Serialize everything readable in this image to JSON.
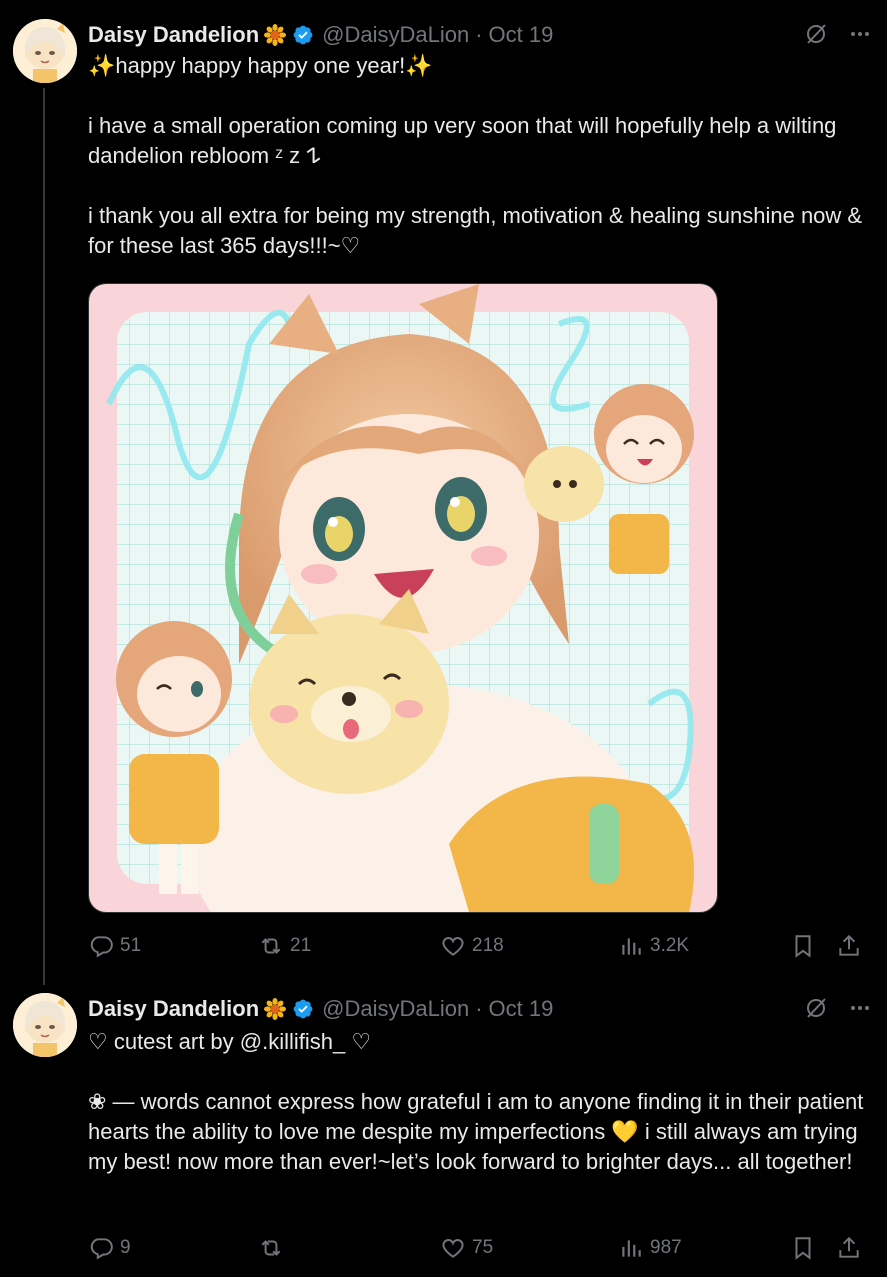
{
  "colors": {
    "background": "#000000",
    "text": "#e7e9ea",
    "muted": "#71767b",
    "verified": "#1d9bf0",
    "divider": "#2f3336"
  },
  "tweets": [
    {
      "author": {
        "name": "Daisy Dandelion",
        "handle": "@DaisyDaLion",
        "badge_icon": "sunflower-emoji",
        "verified_icon": "verified-badge-icon"
      },
      "date": "Oct 19",
      "text": "✨happy happy happy one year!✨\n\ni have a small operation coming up very soon that will hopefully help a wilting dandelion rebloom ᶻ z 𐰁\n\ni thank you all extra for being my strength, motivation & healing sunshine now & for these last 365 days!!!~♡",
      "media": {
        "type": "image",
        "description_icon": "anime-illustration"
      },
      "stats": {
        "replies": "51",
        "reposts": "21",
        "likes": "218",
        "views": "3.2K"
      }
    },
    {
      "author": {
        "name": "Daisy Dandelion",
        "handle": "@DaisyDaLion",
        "badge_icon": "sunflower-emoji",
        "verified_icon": "verified-badge-icon"
      },
      "date": "Oct 19",
      "text": "♡ cutest art by @.killifish_ ♡\n\n❀ — words cannot express how grateful i am to anyone finding it in their patient hearts the ability to love me despite my imperfections 💛 i still always am trying my best! now more than ever!~let’s look forward to brighter days... all together!",
      "stats": {
        "replies": "9",
        "reposts": "",
        "likes": "75",
        "views": "987"
      }
    }
  ]
}
